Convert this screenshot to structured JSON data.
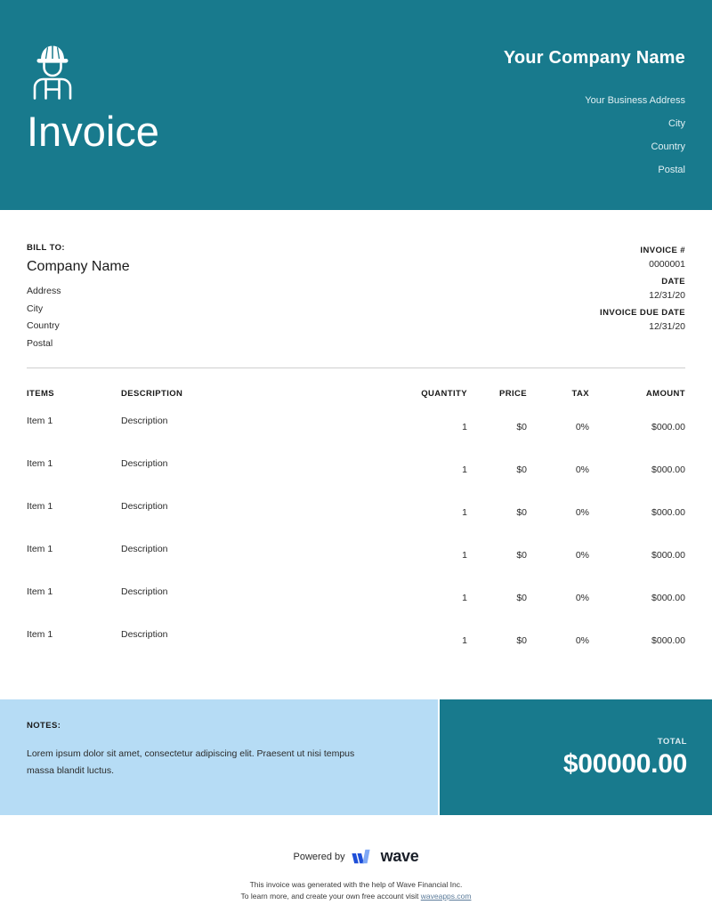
{
  "colors": {
    "teal": "#187A8D",
    "light_blue": "#B6DCF5",
    "white": "#FFFFFF",
    "link": "#5B7B9A"
  },
  "header": {
    "logo_icon": "construction-worker-icon",
    "title": "Invoice",
    "company_name": "Your Company Name",
    "business_lines": [
      "Your Business Address",
      "City",
      "Country",
      "Postal"
    ]
  },
  "bill_to": {
    "label": "BILL TO:",
    "company": "Company Name",
    "lines": [
      "Address",
      "City",
      "Country",
      "Postal"
    ]
  },
  "meta": [
    {
      "label": "INVOICE #",
      "value": "0000001"
    },
    {
      "label": "DATE",
      "value": "12/31/20"
    },
    {
      "label": "INVOICE DUE DATE",
      "value": "12/31/20"
    }
  ],
  "table": {
    "headers": {
      "items": "ITEMS",
      "description": "DESCRIPTION",
      "quantity": "QUANTITY",
      "price": "PRICE",
      "tax": "TAX",
      "amount": "AMOUNT"
    },
    "rows": [
      {
        "item": "Item 1",
        "description": "Description",
        "quantity": "1",
        "price": "$0",
        "tax": "0%",
        "amount": "$000.00"
      },
      {
        "item": "Item 1",
        "description": "Description",
        "quantity": "1",
        "price": "$0",
        "tax": "0%",
        "amount": "$000.00"
      },
      {
        "item": "Item 1",
        "description": "Description",
        "quantity": "1",
        "price": "$0",
        "tax": "0%",
        "amount": "$000.00"
      },
      {
        "item": "Item 1",
        "description": "Description",
        "quantity": "1",
        "price": "$0",
        "tax": "0%",
        "amount": "$000.00"
      },
      {
        "item": "Item 1",
        "description": "Description",
        "quantity": "1",
        "price": "$0",
        "tax": "0%",
        "amount": "$000.00"
      },
      {
        "item": "Item 1",
        "description": "Description",
        "quantity": "1",
        "price": "$0",
        "tax": "0%",
        "amount": "$000.00"
      }
    ]
  },
  "notes": {
    "label": "NOTES:",
    "body": "Lorem ipsum dolor sit amet, consectetur adipiscing elit. Praesent ut nisi tempus massa blandit luctus."
  },
  "total": {
    "label": "TOTAL",
    "value": "$00000.00"
  },
  "footer": {
    "powered_by": "Powered by",
    "brand": "wave",
    "brand_icon": "wave-logo-icon",
    "line1": "This invoice was generated with the help of Wave Financial Inc.",
    "line2_prefix": "To learn more, and create your own free account visit ",
    "link_text": "waveapps.com"
  }
}
